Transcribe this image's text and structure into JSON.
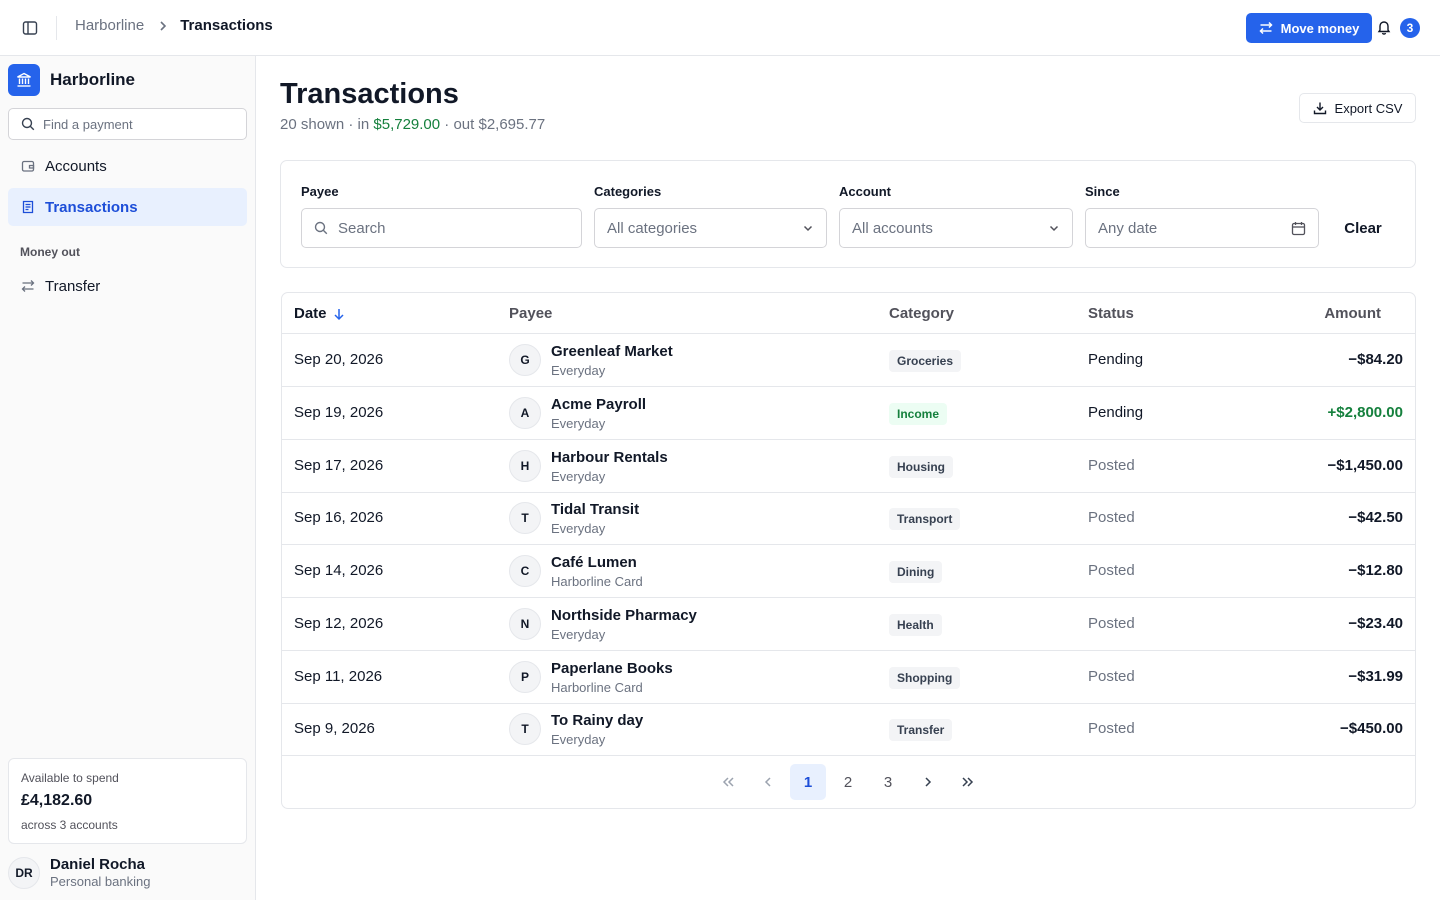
{
  "header": {
    "breadcrumb_root": "Harborline",
    "breadcrumb_current": "Transactions",
    "move_money_label": "Move money",
    "notification_count": "3"
  },
  "sidebar": {
    "brand_name": "Harborline",
    "search_placeholder": "Find a payment",
    "items": [
      {
        "label": "Accounts",
        "icon": "wallet-icon",
        "active": false
      },
      {
        "label": "Transactions",
        "icon": "receipt-icon",
        "active": true
      }
    ],
    "section_label": "Money out",
    "section_items": [
      {
        "label": "Transfer",
        "icon": "arrows-swap-icon"
      }
    ],
    "spend_card": {
      "label": "Available to spend",
      "amount": "£4,182.60",
      "sub": "across 3 accounts"
    },
    "user": {
      "initials": "DR",
      "name": "Daniel Rocha",
      "plan": "Personal banking"
    }
  },
  "page": {
    "title": "Transactions",
    "summary_prefix": "20 shown · in ",
    "summary_in": "$5,729.00",
    "summary_suffix": " · out $2,695.77",
    "export_label": "Export CSV"
  },
  "filters": {
    "payee_label": "Payee",
    "payee_placeholder": "Search",
    "categories_label": "Categories",
    "categories_value": "All categories",
    "account_label": "Account",
    "account_value": "All accounts",
    "since_label": "Since",
    "since_placeholder": "Any date",
    "clear_label": "Clear"
  },
  "table": {
    "columns": {
      "date": "Date",
      "payee": "Payee",
      "category": "Category",
      "status": "Status",
      "amount": "Amount"
    },
    "rows": [
      {
        "date": "Sep 20, 2026",
        "initial": "G",
        "payee": "Greenleaf Market",
        "account": "Everyday",
        "category": "Groceries",
        "status": "Pending",
        "amount": "−$84.20",
        "credit": false
      },
      {
        "date": "Sep 19, 2026",
        "initial": "A",
        "payee": "Acme Payroll",
        "account": "Everyday",
        "category": "Income",
        "status": "Pending",
        "amount": "+$2,800.00",
        "credit": true
      },
      {
        "date": "Sep 17, 2026",
        "initial": "H",
        "payee": "Harbour Rentals",
        "account": "Everyday",
        "category": "Housing",
        "status": "Posted",
        "amount": "−$1,450.00",
        "credit": false
      },
      {
        "date": "Sep 16, 2026",
        "initial": "T",
        "payee": "Tidal Transit",
        "account": "Everyday",
        "category": "Transport",
        "status": "Posted",
        "amount": "−$42.50",
        "credit": false
      },
      {
        "date": "Sep 14, 2026",
        "initial": "C",
        "payee": "Café Lumen",
        "account": "Harborline Card",
        "category": "Dining",
        "status": "Posted",
        "amount": "−$12.80",
        "credit": false
      },
      {
        "date": "Sep 12, 2026",
        "initial": "N",
        "payee": "Northside Pharmacy",
        "account": "Everyday",
        "category": "Health",
        "status": "Posted",
        "amount": "−$23.40",
        "credit": false
      },
      {
        "date": "Sep 11, 2026",
        "initial": "P",
        "payee": "Paperlane Books",
        "account": "Harborline Card",
        "category": "Shopping",
        "status": "Posted",
        "amount": "−$31.99",
        "credit": false
      },
      {
        "date": "Sep 9, 2026",
        "initial": "T",
        "payee": "To Rainy day",
        "account": "Everyday",
        "category": "Transfer",
        "status": "Posted",
        "amount": "−$450.00",
        "credit": false
      }
    ]
  },
  "pagination": {
    "pages": [
      "1",
      "2",
      "3"
    ],
    "current": "1"
  },
  "colors": {
    "accent": "#2563eb",
    "accent_soft": "#e8f0fe",
    "credit_green": "#15803d"
  }
}
